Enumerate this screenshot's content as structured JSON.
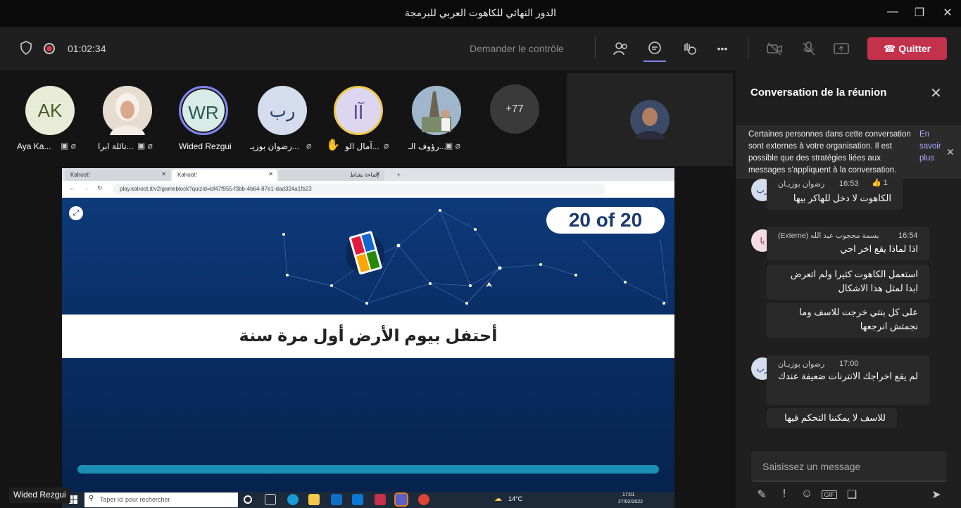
{
  "window": {
    "title": "الدور النهائي للكاهوت العربي للبرمجة",
    "minimize": "—",
    "maximize": "❐",
    "close": "✕"
  },
  "toolbar": {
    "timer": "01:02:34",
    "request_control": "Demander le contrôle",
    "more": "•••",
    "leave": "Quitter"
  },
  "participants": [
    {
      "initials": "AK",
      "name": "Aya Ka...",
      "color": "#e8ecd6"
    },
    {
      "initials": "",
      "name": "نائلة ابرا...",
      "color": "#e8ddd0"
    },
    {
      "initials": "WR",
      "name": "Wided Rezgui",
      "color": "#d9ebe6"
    },
    {
      "initials": "رب",
      "name": "رضوان بوزيـ...",
      "color": "#d5dced"
    },
    {
      "initials": "آا",
      "name": "آمال الو...",
      "color": "#dcd6f0"
    },
    {
      "initials": "",
      "name": "رؤوف الـ...",
      "color": "#8aa0b8"
    },
    {
      "initials": "+77",
      "name": "",
      "color": "#3a3a3a"
    }
  ],
  "shared_screen": {
    "tab1": "Kahoot!",
    "tab2": "Kahoot!",
    "tab3": "إضاءة نشاط",
    "url": "play.kahoot.it/v2/gameblock?quizId=bf47f955-f3bb-4b64-87e1-dad324a1fb23",
    "counter": "20 of 20",
    "question": "أحتفل بيوم الأرض أول مرة سنة",
    "taskbar_search": "Taper ici pour rechercher",
    "temp": "14°C",
    "time": "17:01",
    "date": "27/02/2022"
  },
  "name_tag": "Wided Rezgui",
  "chat": {
    "title": "Conversation de la réunion",
    "notice": "Certaines personnes dans cette conversation sont externes à votre organisation. Il est possible que des stratégies liées aux messages s’appliquent à la conversation.",
    "notice_link": "En savoir plus",
    "messages": [
      {
        "time": "16:53",
        "author": "رضوان بوزيـان",
        "text": "الكاهوت لا دخل للهاكر بيها",
        "reaction": "👍 1"
      },
      {
        "time": "16:54",
        "author": "بسمة محجوب عبد الله (Externe)",
        "text": "اذا لماذا يقع اخر اجي"
      },
      {
        "text": "استعمل الكاهوت كثيرا ولم اتعرض ابدا لمثل هذا الاشكال"
      },
      {
        "text": "على كل بنتي خرجت للاسف وما نجمتش انرجعها"
      },
      {
        "time": "17:00",
        "author": "رضوان بوزيـان",
        "text": "لم يقع اخراجك الانترنات ضعيفة عندك"
      },
      {
        "text": "للاسف لا يمكننا التحكم فيها"
      }
    ],
    "avatar_rb": "رب",
    "avatar_ba": "با",
    "compose_placeholder": "Saisissez un message"
  }
}
